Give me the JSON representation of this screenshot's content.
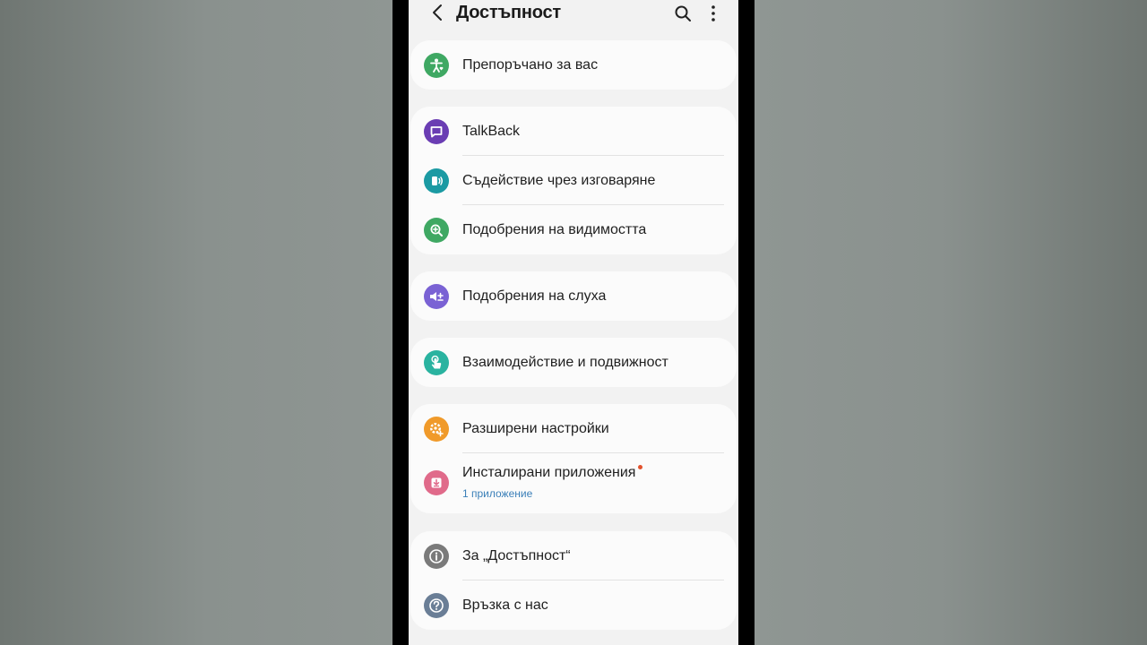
{
  "header": {
    "title": "Достъпност"
  },
  "groups": [
    {
      "items": [
        {
          "label": "Препоръчано за вас",
          "icon": "accessibility-heart-icon",
          "color": "#3fa863"
        }
      ]
    },
    {
      "items": [
        {
          "label": "TalkBack",
          "icon": "talkback-icon",
          "color": "#6a3db3"
        },
        {
          "label": "Съдействие чрез изговаряне",
          "icon": "speech-assist-icon",
          "color": "#1b9aa3"
        },
        {
          "label": "Подобрения на видимостта",
          "icon": "magnify-icon",
          "color": "#3fa863"
        }
      ]
    },
    {
      "items": [
        {
          "label": "Подобрения на слуха",
          "icon": "hearing-icon",
          "color": "#7a62d4"
        }
      ]
    },
    {
      "items": [
        {
          "label": "Взаимодействие и подвижност",
          "icon": "touch-icon",
          "color": "#2ab3a0"
        }
      ]
    },
    {
      "items": [
        {
          "label": "Разширени настройки",
          "icon": "advanced-settings-icon",
          "color": "#f09a2a"
        },
        {
          "label": "Инсталирани приложения",
          "icon": "installed-apps-icon",
          "color": "#e06a8a",
          "sub": "1 приложение"
        }
      ]
    },
    {
      "items": [
        {
          "label": "За „Достъпност“",
          "icon": "info-icon",
          "color": "#7a7a7a"
        },
        {
          "label": "Връзка с нас",
          "icon": "help-icon",
          "color": "#6a7e96"
        }
      ]
    }
  ]
}
